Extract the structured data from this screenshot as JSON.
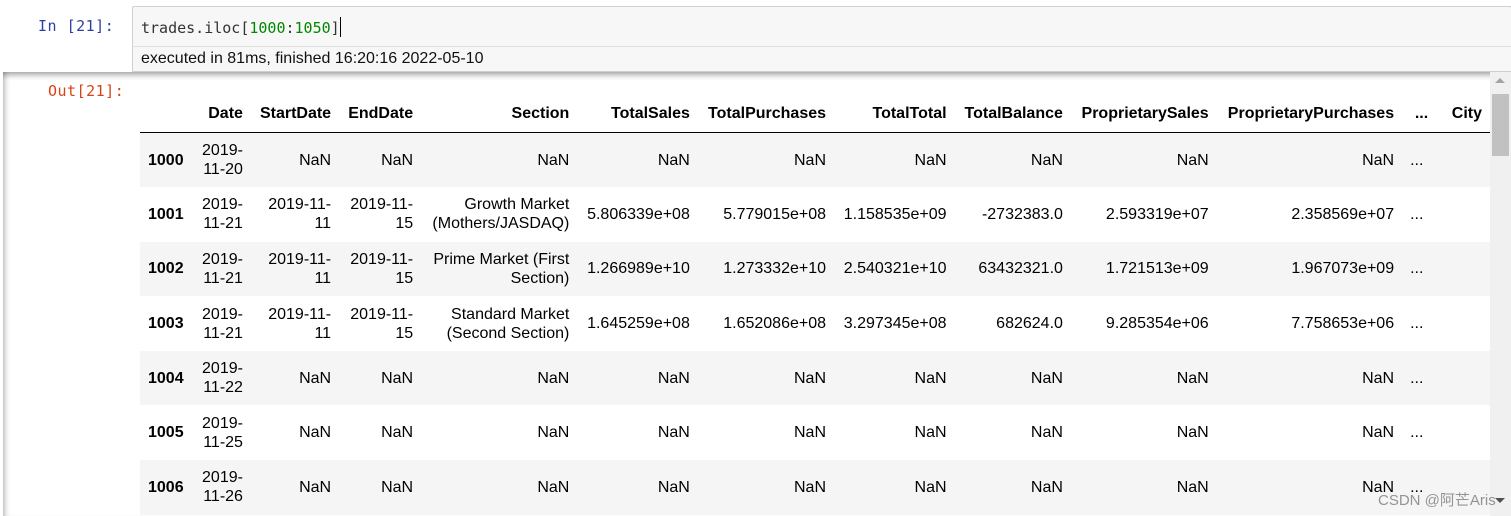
{
  "input_cell": {
    "prompt": "In  [21]:",
    "code_prefix": "trades.iloc[",
    "code_start": "1000",
    "code_colon": ":",
    "code_end": "1050",
    "code_suffix": "]",
    "exec_info": "executed in 81ms, finished 16:20:16 2022-05-10"
  },
  "output_cell": {
    "prompt": "Out[21]:",
    "columns": [
      "",
      "Date",
      "StartDate",
      "EndDate",
      "Section",
      "TotalSales",
      "TotalPurchases",
      "TotalTotal",
      "TotalBalance",
      "ProprietarySales",
      "ProprietaryPurchases",
      "...",
      "City"
    ],
    "rows": [
      {
        "index": "1000",
        "cells": [
          "2019-11-20",
          "NaN",
          "NaN",
          "NaN",
          "NaN",
          "NaN",
          "NaN",
          "NaN",
          "NaN",
          "NaN",
          "...",
          ""
        ]
      },
      {
        "index": "1001",
        "cells": [
          "2019-11-21",
          "2019-11-11",
          "2019-11-15",
          "Growth Market (Mothers/JASDAQ)",
          "5.806339e+08",
          "5.779015e+08",
          "1.158535e+09",
          "-2732383.0",
          "2.593319e+07",
          "2.358569e+07",
          "...",
          ""
        ]
      },
      {
        "index": "1002",
        "cells": [
          "2019-11-21",
          "2019-11-11",
          "2019-11-15",
          "Prime Market (First Section)",
          "1.266989e+10",
          "1.273332e+10",
          "2.540321e+10",
          "63432321.0",
          "1.721513e+09",
          "1.967073e+09",
          "...",
          ""
        ]
      },
      {
        "index": "1003",
        "cells": [
          "2019-11-21",
          "2019-11-11",
          "2019-11-15",
          "Standard Market (Second Section)",
          "1.645259e+08",
          "1.652086e+08",
          "3.297345e+08",
          "682624.0",
          "9.285354e+06",
          "7.758653e+06",
          "...",
          ""
        ]
      },
      {
        "index": "1004",
        "cells": [
          "2019-11-22",
          "NaN",
          "NaN",
          "NaN",
          "NaN",
          "NaN",
          "NaN",
          "NaN",
          "NaN",
          "NaN",
          "...",
          ""
        ]
      },
      {
        "index": "1005",
        "cells": [
          "2019-11-25",
          "NaN",
          "NaN",
          "NaN",
          "NaN",
          "NaN",
          "NaN",
          "NaN",
          "NaN",
          "NaN",
          "...",
          ""
        ]
      },
      {
        "index": "1006",
        "cells": [
          "2019-11-26",
          "NaN",
          "NaN",
          "NaN",
          "NaN",
          "NaN",
          "NaN",
          "NaN",
          "NaN",
          "NaN",
          "...",
          ""
        ]
      }
    ]
  },
  "watermark": "CSDN @阿芒Aris"
}
